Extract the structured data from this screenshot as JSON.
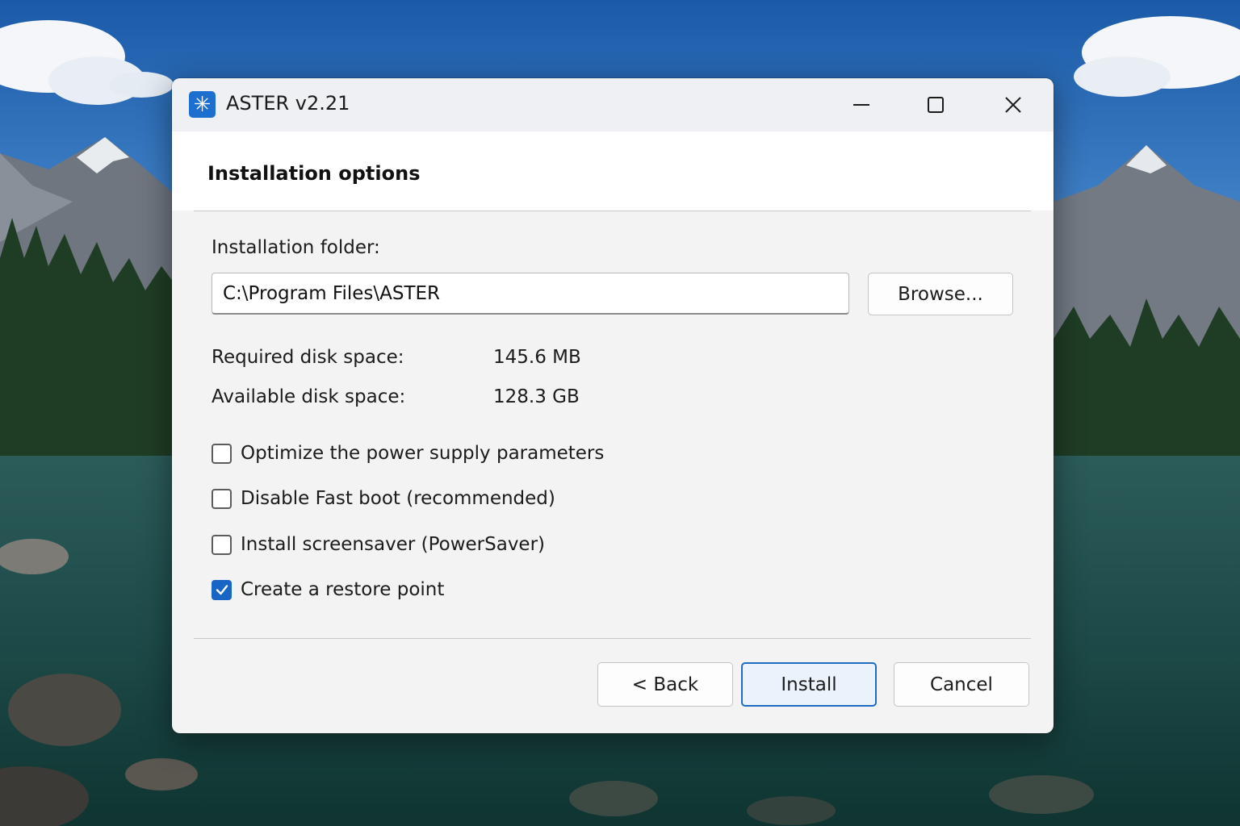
{
  "window": {
    "title": "ASTER v2.21",
    "icon": "asterisk-app-icon",
    "controls": [
      "minimize-icon",
      "maximize-icon",
      "close-icon"
    ]
  },
  "page": {
    "heading": "Installation options"
  },
  "folder": {
    "label": "Installation folder:",
    "value": "C:\\Program Files\\ASTER",
    "browse_label": "Browse..."
  },
  "disk": {
    "required_label": "Required disk space:",
    "required_value": "145.6 MB",
    "available_label": "Available disk space:",
    "available_value": "128.3 GB"
  },
  "options": [
    {
      "label": "Optimize the power supply parameters",
      "checked": false
    },
    {
      "label": "Disable Fast boot (recommended)",
      "checked": false
    },
    {
      "label": "Install screensaver (PowerSaver)",
      "checked": false
    },
    {
      "label": "Create a restore point",
      "checked": true
    }
  ],
  "footer": {
    "back_label": "< Back",
    "install_label": "Install",
    "cancel_label": "Cancel"
  },
  "colors": {
    "accent": "#1865c4",
    "primary_button_border": "#1f6bc4",
    "app_icon_bg": "#1d6fcf"
  }
}
